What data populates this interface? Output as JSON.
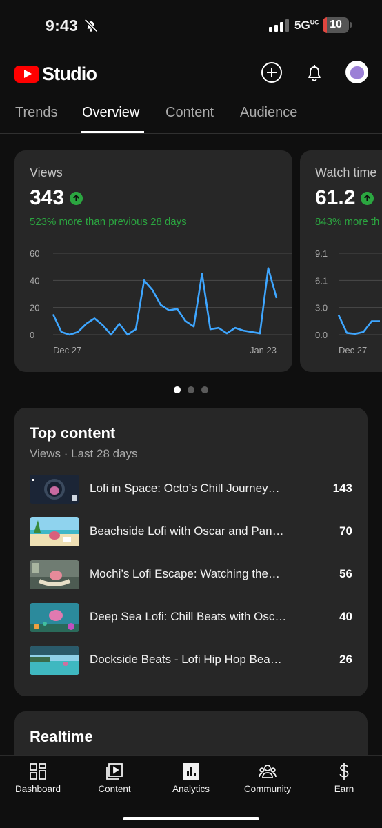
{
  "status_bar": {
    "time": "9:43",
    "network": "5G",
    "network_sup": "UC",
    "battery": "10"
  },
  "header": {
    "app_name": "Studio"
  },
  "tabs": [
    {
      "label": "Trends"
    },
    {
      "label": "Overview"
    },
    {
      "label": "Content"
    },
    {
      "label": "Audience"
    }
  ],
  "active_tab": "Overview",
  "metrics": [
    {
      "label": "Views",
      "value": "343",
      "change": "523% more than previous 28 days"
    },
    {
      "label": "Watch time",
      "value": "61.2",
      "change": "843% more th"
    }
  ],
  "chart_data": [
    {
      "type": "line",
      "title": "Views",
      "x_labels": [
        "Dec 27",
        "Jan 23"
      ],
      "y_ticks": [
        "60",
        "40",
        "20",
        "0"
      ],
      "ylim": [
        0,
        60
      ],
      "values": [
        15,
        2,
        0,
        2,
        8,
        12,
        7,
        0,
        8,
        0,
        4,
        40,
        33,
        22,
        18,
        19,
        10,
        6,
        45,
        4,
        5,
        1,
        5,
        3,
        2,
        1,
        49,
        27
      ],
      "color": "#3ea6ff",
      "grid": true
    },
    {
      "type": "line",
      "title": "Watch time",
      "x_labels": [
        "Dec 27"
      ],
      "y_ticks": [
        "9.1",
        "6.1",
        "3.0",
        "0.0"
      ],
      "ylim": [
        0,
        9.1
      ],
      "values": [
        2.2,
        0.2,
        0.1,
        0.3,
        1.5,
        1.5
      ],
      "color": "#3ea6ff",
      "grid": true
    }
  ],
  "pagination": {
    "count": 3,
    "active": 0
  },
  "top_content": {
    "title": "Top content",
    "subtitle": "Views · Last 28 days",
    "items": [
      {
        "title": "Lofi in Space: Octo’s Chill Journey…",
        "value": "143"
      },
      {
        "title": "Beachside Lofi with Oscar and Pan…",
        "value": "70"
      },
      {
        "title": "Mochi’s Lofi Escape: Watching the…",
        "value": "56"
      },
      {
        "title": "Deep Sea Lofi: Chill Beats with Osc…",
        "value": "40"
      },
      {
        "title": "Dockside Beats - Lofi Hip Hop Bea…",
        "value": "26"
      }
    ]
  },
  "realtime": {
    "title": "Realtime"
  },
  "bottom_nav": [
    {
      "label": "Dashboard",
      "icon": "dashboard-icon"
    },
    {
      "label": "Content",
      "icon": "content-icon"
    },
    {
      "label": "Analytics",
      "icon": "analytics-icon"
    },
    {
      "label": "Community",
      "icon": "community-icon"
    },
    {
      "label": "Earn",
      "icon": "earn-icon"
    }
  ],
  "colors": {
    "accent_green": "#2ba640",
    "chart_line": "#3ea6ff",
    "brand_red": "#ff0000"
  }
}
